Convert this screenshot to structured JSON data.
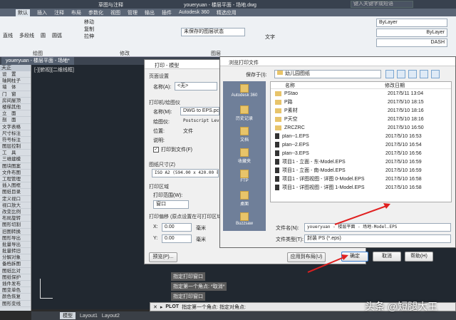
{
  "app": {
    "title": "youeryuan - 楼层平面 - 场地.dwg",
    "window_title_small": "草图与注释",
    "search_placeholder": "键入关键字或短语"
  },
  "ribbon_tabs": [
    "默认",
    "插入",
    "注释",
    "布局",
    "参数化",
    "视图",
    "管理",
    "输出",
    "插件",
    "Autodesk 360",
    "精选应用"
  ],
  "ribbon": {
    "tools_left": [
      "直线",
      "多段线",
      "圆",
      "圆弧"
    ],
    "tools_mid": [
      "移动",
      "复制",
      "拉伸"
    ],
    "layer_value": "未保存的图层状态",
    "text_tool": "文字",
    "bylayer1": "ByLayer",
    "bylayer2": "ByLayer",
    "dash": "DASH",
    "panel_draw": "绘图",
    "panel_modify": "修改",
    "panel_layer": "图层"
  },
  "doc_tab": "youeryuan - 楼层平面 - 场地*",
  "viewport_label": "[-][俯视][二维线框]",
  "tianzheng": {
    "title": "天正",
    "items": [
      "设　置",
      "轴网柱子",
      "墙　体",
      "门　窗",
      "房间屋顶",
      "楼梯其他",
      "立　面",
      "剖　面",
      "文字表格",
      "尺寸标注",
      "符号标注",
      "图层控制",
      "工　具",
      "三维建模",
      "图块图案",
      "文件布图",
      "工程管理",
      "插入图框",
      "图纸目录",
      "定义视口",
      "视口放大",
      "改变比例",
      "布局旋转",
      "图形切割",
      "旧图转换",
      "图形导出",
      "批量导出",
      "批量转旧",
      "分解对象",
      "备档拆图",
      "图纸比对",
      "图纸保护",
      "插件发布",
      "图变单色",
      "颜色恢复",
      "图形变线"
    ]
  },
  "print_dialog": {
    "title": "打印 - 模型",
    "page_setup": "页面设置",
    "name_label": "名称(A):",
    "name_value": "<无>",
    "printer_section": "打印机/绘图仪",
    "printer_name_label": "名称(M):",
    "printer_name_value": "DWG to EPS.pc3",
    "plotter_label": "绘图仪:",
    "plotter_value": "Postscript Level 1",
    "location_label": "位置:",
    "location_value": "文件",
    "desc_label": "说明:",
    "print_to_file": "打印到文件(F)",
    "paper_section": "图纸尺寸(Z)",
    "paper_value": "ISO A2 (594.00 x 420.00 毫米)",
    "area_section": "打印区域",
    "range_label": "打印范围(W):",
    "range_value": "窗口",
    "offset_section": "打印偏移 (原点设置在可打印区域)",
    "x_label": "X:",
    "x_value": "0.00",
    "y_label": "Y:",
    "y_value": "0.00",
    "unit_mm": "毫米",
    "preview_btn": "预览(P)...",
    "apply_btn": "应用到布局(U)",
    "ok_btn": "确定",
    "cancel_btn": "取消",
    "help_btn": "帮助(H)"
  },
  "file_dialog": {
    "title": "浏览打印文件",
    "save_in_label": "保存于(I):",
    "save_in_value": "幼儿园图纸",
    "col_name": "名称",
    "col_date": "修改日期",
    "places": [
      "Autodesk 360",
      "历史记录",
      "文档",
      "收藏夹",
      "FTP",
      "桌面",
      "Buzzsaw"
    ],
    "files": [
      {
        "name": "PStao",
        "date": "2017/5/11 13:04",
        "type": "folder"
      },
      {
        "name": "P路",
        "date": "2017/5/10 18:15",
        "type": "folder"
      },
      {
        "name": "P素材",
        "date": "2017/5/10 18:16",
        "type": "folder"
      },
      {
        "name": "P天空",
        "date": "2017/5/10 18:16",
        "type": "folder"
      },
      {
        "name": "ZRCZRC",
        "date": "2017/5/10 16:50",
        "type": "folder"
      },
      {
        "name": "plan--1.EPS",
        "date": "2017/5/10 16:53",
        "type": "file"
      },
      {
        "name": "plan--2.EPS",
        "date": "2017/5/10 16:54",
        "type": "file"
      },
      {
        "name": "plan--3.EPS",
        "date": "2017/5/10 16:56",
        "type": "file"
      },
      {
        "name": "项目1 - 立面 - 东-Model.EPS",
        "date": "2017/5/10 16:59",
        "type": "file"
      },
      {
        "name": "项目1 - 立面 - 南-Model.EPS",
        "date": "2017/5/10 16:59",
        "type": "file"
      },
      {
        "name": "项目1 - 详图视图 - 详图 0-Model.EPS",
        "date": "2017/5/10 16:58",
        "type": "file"
      },
      {
        "name": "项目1 - 详图视图 - 详图 1-Model.EPS",
        "date": "2017/5/10 16:58",
        "type": "file"
      }
    ],
    "filename_label": "文件名(N):",
    "filename_value": "youeryuan - 楼层平面 - 场地-Model.EPS",
    "filetype_label": "文件类型(T):",
    "filetype_value": "封装 PS (*.eps)",
    "save_btn": "保存(S)",
    "cancel_btn": "取消"
  },
  "command": {
    "history": [
      "指定打印窗口",
      "指定第一个角点: *取消*",
      "指定打印窗口"
    ],
    "prompt_cmd": "PLOT",
    "prompt_text": "指定第一个角点: 指定对角点:"
  },
  "bottom_tabs": [
    "模型",
    "Layout1",
    "Layout2"
  ],
  "watermark": "头条 @短腿大王"
}
